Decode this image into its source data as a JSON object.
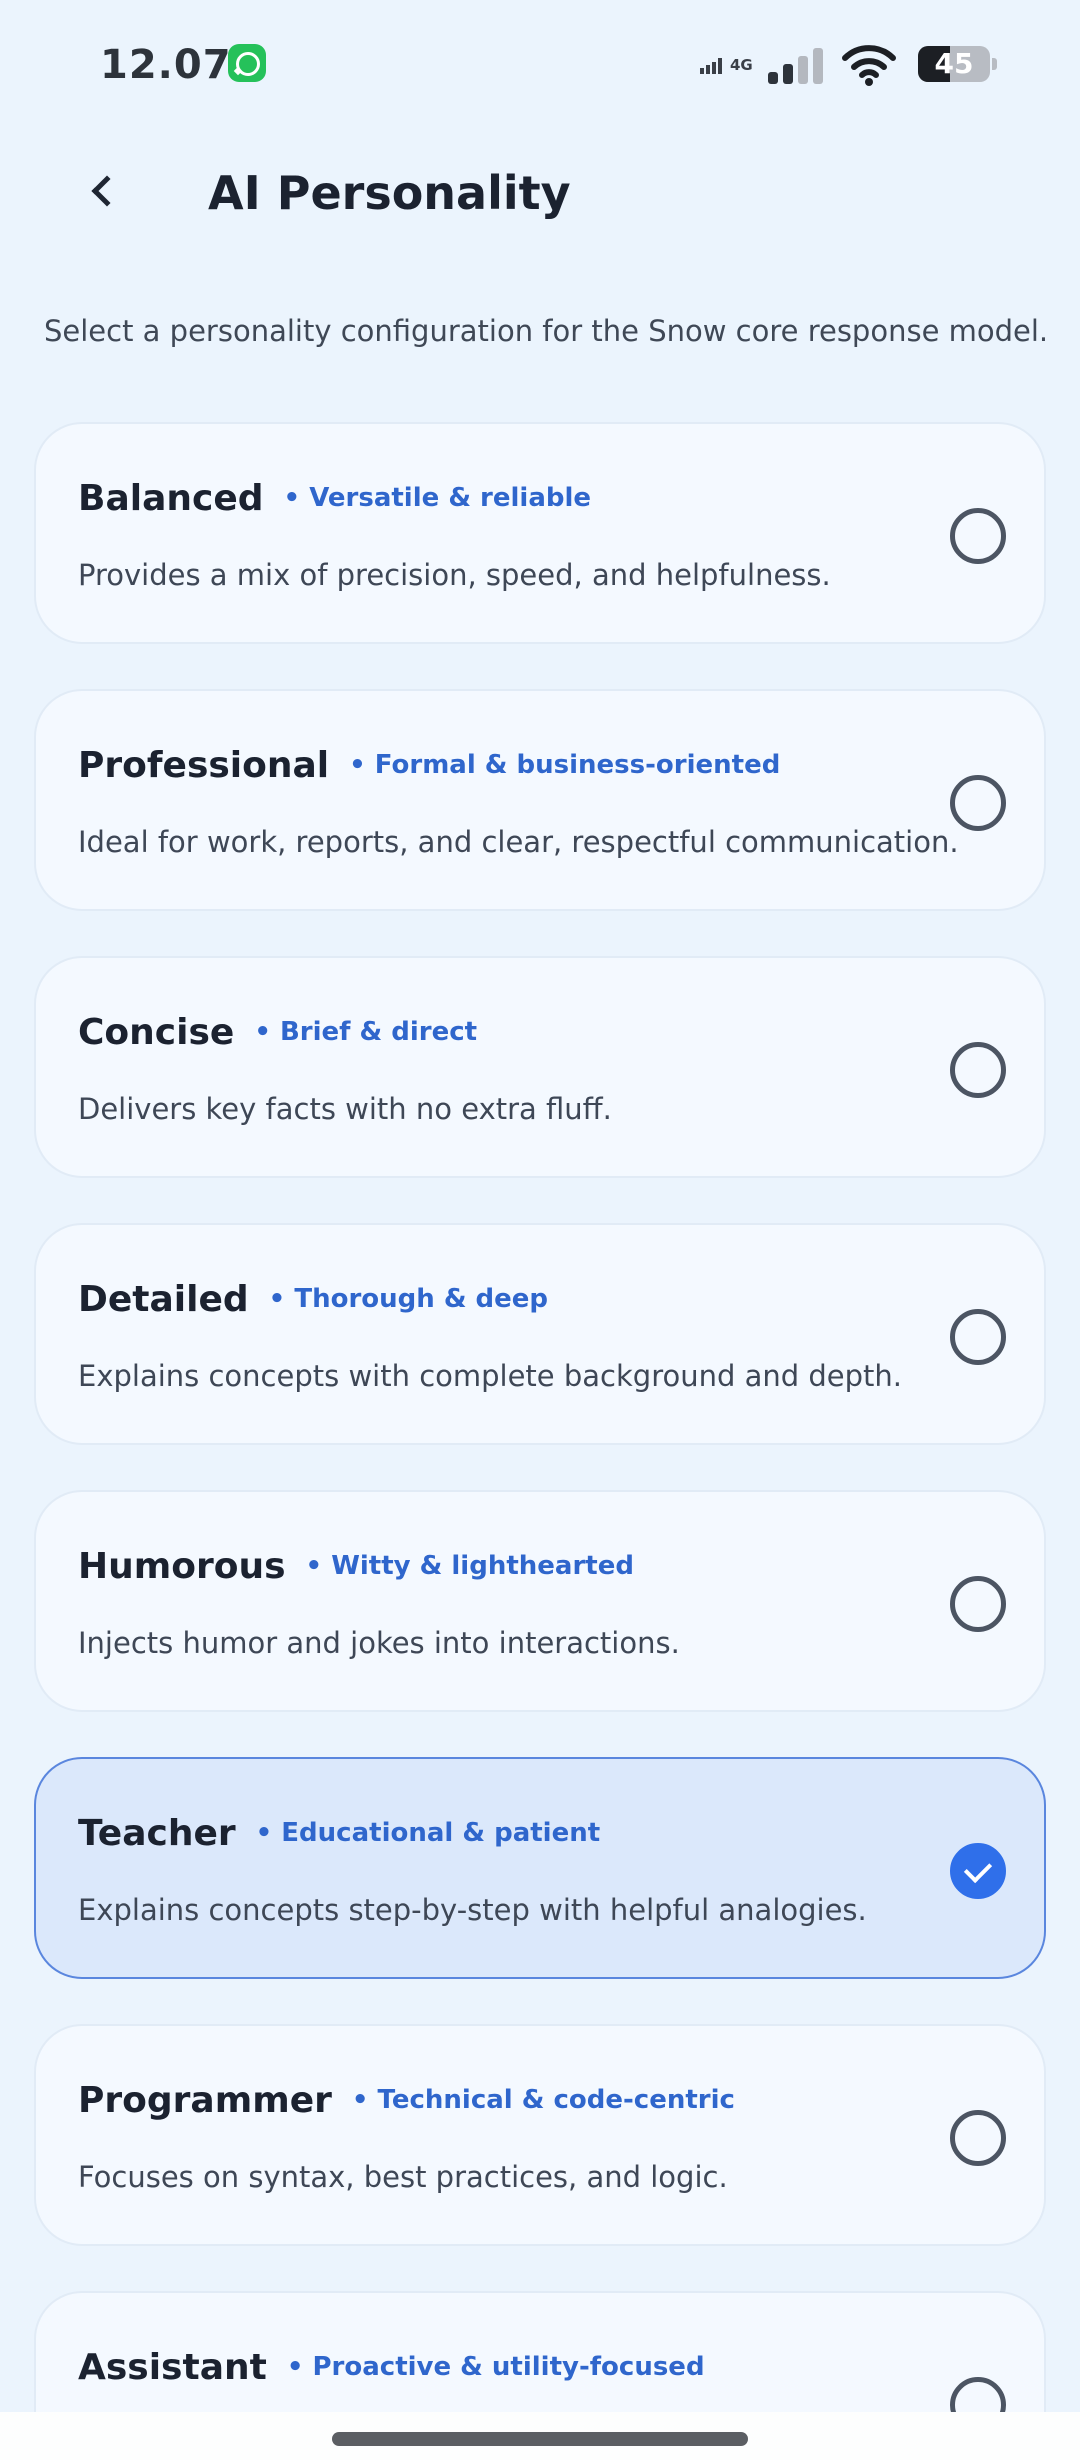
{
  "status_bar": {
    "time": "12.07",
    "network": "4G",
    "battery": "45",
    "battery_fraction": 0.45
  },
  "header": {
    "title": "AI Personality"
  },
  "subtitle": "Select a personality configuration for the Snow core response model.",
  "options": [
    {
      "name": "Balanced",
      "tag": "• Versatile & reliable",
      "description": "Provides a mix of precision, speed, and helpfulness.",
      "selected": false
    },
    {
      "name": "Professional",
      "tag": "• Formal & business-oriented",
      "description": "Ideal for work, reports, and clear, respectful communication.",
      "selected": false
    },
    {
      "name": "Concise",
      "tag": "• Brief & direct",
      "description": "Delivers key facts with no extra fluff.",
      "selected": false
    },
    {
      "name": "Detailed",
      "tag": "• Thorough & deep",
      "description": "Explains concepts with complete background and depth.",
      "selected": false
    },
    {
      "name": "Humorous",
      "tag": "• Witty & lighthearted",
      "description": "Injects humor and jokes into interactions.",
      "selected": false
    },
    {
      "name": "Teacher",
      "tag": "• Educational & patient",
      "description": "Explains concepts step-by-step with helpful analogies.",
      "selected": true
    },
    {
      "name": "Programmer",
      "tag": "• Technical & code-centric",
      "description": "Focuses on syntax, best practices, and logic.",
      "selected": false
    },
    {
      "name": "Assistant",
      "tag": "• Proactive & utility-focused",
      "description": "",
      "selected": false
    }
  ],
  "colors": {
    "accent": "#2f6fea",
    "tag": "#2f66cc",
    "background": "#ebf4fd",
    "card": "#f4f9ff",
    "selected_card": "#dbe8fb"
  }
}
